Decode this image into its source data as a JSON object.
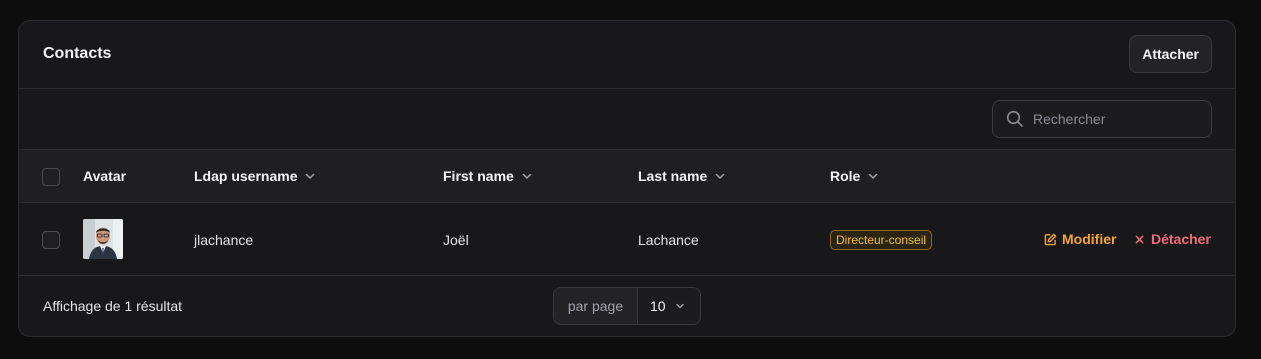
{
  "panel": {
    "title": "Contacts",
    "attach_label": "Attacher"
  },
  "search": {
    "placeholder": "Rechercher",
    "icon": "search-icon"
  },
  "table": {
    "columns": {
      "avatar": "Avatar",
      "ldap": "Ldap username",
      "first_name": "First name",
      "last_name": "Last name",
      "role": "Role"
    },
    "rows": [
      {
        "ldap": "jlachance",
        "first_name": "Joël",
        "last_name": "Lachance",
        "role": "Directeur-conseil",
        "edit_label": "Modifier",
        "detach_label": "Détacher"
      }
    ]
  },
  "footer": {
    "result_text": "Affichage de 1 résultat",
    "per_page_label": "par page",
    "per_page_value": "10"
  },
  "colors": {
    "accent_edit": "#f5a524",
    "accent_detach": "#f06b78",
    "badge_text": "#f2c230"
  }
}
